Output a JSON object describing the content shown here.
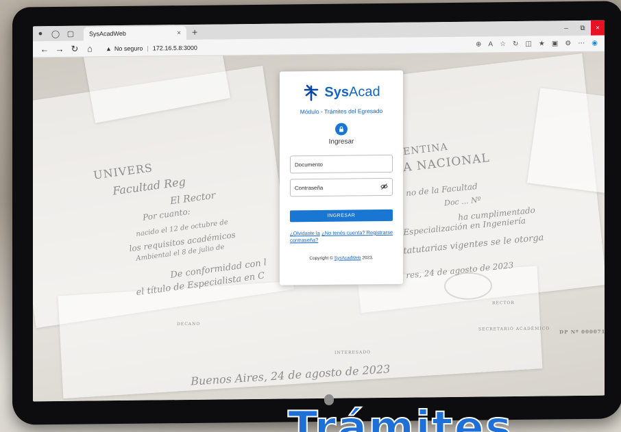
{
  "browser": {
    "tab_title": "SysAcadWeb",
    "tab_close": "×",
    "new_tab": "+",
    "security_label": "No seguro",
    "url": "172.16.5.8:3000",
    "window_minimize": "–",
    "window_restore": "⧉",
    "window_close": "×"
  },
  "login": {
    "brand_bold": "Sys",
    "brand_light": "Acad",
    "module": "Módulo - Trámites del Egresado",
    "title": "Ingresar",
    "document_placeholder": "Documento",
    "password_placeholder": "Contraseña",
    "submit_label": "INGRESAR",
    "forgot_link": "¿Olvidaste la contraseña?",
    "register_link": "¿No tenés cuenta? Registrarse",
    "copyright_prefix": "Copyright ©",
    "copyright_link": "SysAcadWeb",
    "copyright_year": "2023."
  },
  "background_text": {
    "university": "UNIVERS",
    "nacional": "A NACIONAL",
    "tina": "ENTINA",
    "facultad": "Facultad Reg",
    "rector": "El Rector",
    "por_cuanto": "Por cuanto:",
    "nacido": "nacido el 12 de octubre de",
    "requisitos": "los requisitos académicos",
    "ambiental": "Ambiental el 8 de julio de",
    "conformidad": "De conformidad con l",
    "titulo": "el título de Especialista en C",
    "facultad_right": "no de la Facultad",
    "doc": "Doc ... Nº",
    "cumplimentado": "ha cumplimentado",
    "especializacion": "Especialización en Ingeniería",
    "estatutarias": "tatutarias vigentes se le otorga",
    "fecha_right": "res, 24 de agosto de 2023",
    "fecha_bottom": "Buenos Aires, 24 de agosto de 2023",
    "rector_label": "RECTOR",
    "secretario_label": "SECRETARIO ACADÉMICO",
    "decano_label": "DECANO",
    "interesado_label": "INTERESADO",
    "dp_label": "DP Nº 000071",
    "headline": "Trámites"
  },
  "colors": {
    "brand_blue": "#1565c0",
    "button_blue": "#1976d2",
    "close_red": "#e81123"
  }
}
